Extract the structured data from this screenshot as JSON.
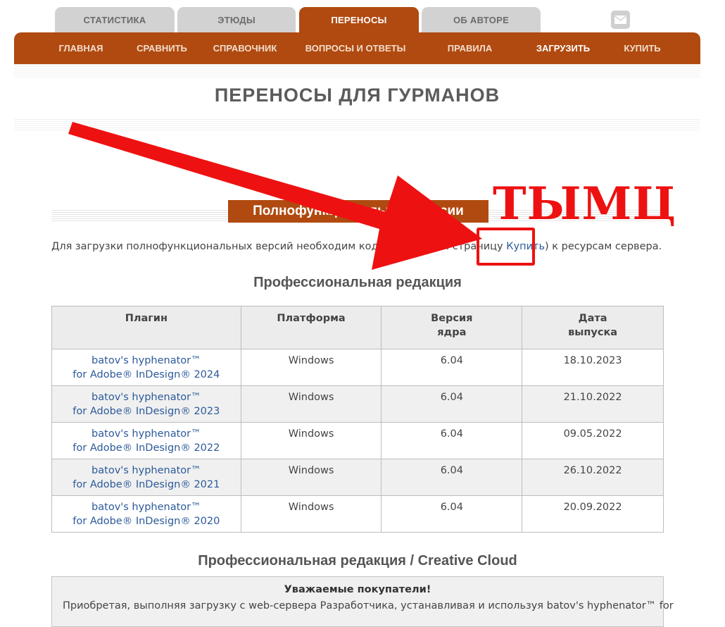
{
  "tabs": [
    "СТАТИСТИКА",
    "ЭТЮДЫ",
    "ПЕРЕНОСЫ",
    "ОБ АВТОРЕ"
  ],
  "active_tab": "ПЕРЕНОСЫ",
  "mail_icon": "mail-icon",
  "menu": [
    "ГЛАВНАЯ",
    "СРАВНИТЬ",
    "СПРАВОЧНИК",
    "ВОПРОСЫ И ОТВЕТЫ",
    "ПРАВИЛА",
    "ЗАГРУЗИТЬ",
    "КУПИТЬ"
  ],
  "page_title": "ПЕРЕНОСЫ ДЛЯ ГУРМАНОВ",
  "section_title": "Полнофункциональные версии",
  "intro": {
    "before": "Для загрузки полнофункциональных версий необходим код доступа (см. страницу ",
    "link": "Купить",
    "after": ") к ресурсам сервера."
  },
  "annotation_text": "ТЫМЦ",
  "pro_title": "Профессиональная редакция",
  "table": {
    "headers": [
      "Плагин",
      "Платформа",
      "Версия\nядра",
      "Дата\nвыпуска"
    ],
    "rows": [
      {
        "plugin_line1": "batov's hyphenator™",
        "plugin_line2": "for Adobe® InDesign® 2024",
        "platform": "Windows",
        "version": "6.04",
        "date": "18.10.2023"
      },
      {
        "plugin_line1": "batov's hyphenator™",
        "plugin_line2": "for Adobe® InDesign® 2023",
        "platform": "Windows",
        "version": "6.04",
        "date": "21.10.2022"
      },
      {
        "plugin_line1": "batov's hyphenator™",
        "plugin_line2": "for Adobe® InDesign® 2022",
        "platform": "Windows",
        "version": "6.04",
        "date": "09.05.2022"
      },
      {
        "plugin_line1": "batov's hyphenator™",
        "plugin_line2": "for Adobe® InDesign® 2021",
        "platform": "Windows",
        "version": "6.04",
        "date": "26.10.2022"
      },
      {
        "plugin_line1": "batov's hyphenator™",
        "plugin_line2": "for Adobe® InDesign® 2020",
        "platform": "Windows",
        "version": "6.04",
        "date": "20.09.2022"
      }
    ]
  },
  "cc_title": "Профессиональная редакция / Creative Cloud",
  "notice": {
    "title": "Уважаемые покупатели!",
    "text": "Приобретая, выполняя загрузку с web-сервера Разработчика, устанавливая и используя batov's hyphenator™ for"
  },
  "colors": {
    "brand": "#b04a10",
    "annotation": "#ee1111",
    "link": "#2c5a9a"
  }
}
